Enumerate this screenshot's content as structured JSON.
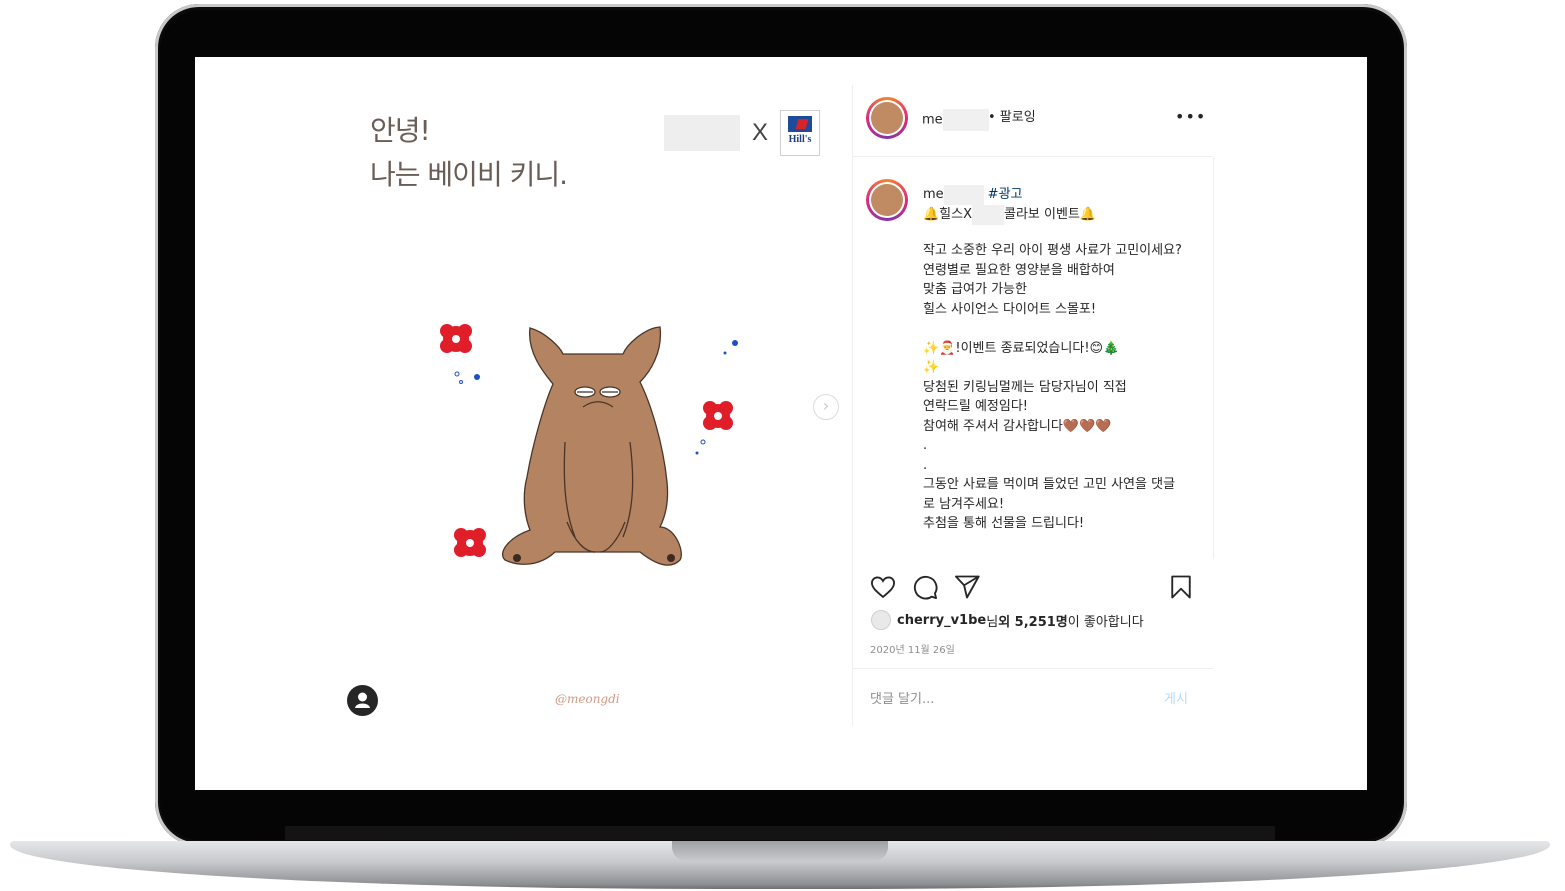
{
  "post_image": {
    "headline_line1": "안녕!",
    "headline_line2": "나는 베이비 키니.",
    "collab_x": "X",
    "partner_logo_text": "Hill's",
    "signature": "@meongdi",
    "next_icon": "chevron-right-icon",
    "tag_icon": "user-tag-icon"
  },
  "header": {
    "username_prefix": "me",
    "follow_label": "• 팔로잉",
    "more_label": "•••"
  },
  "caption": {
    "username_prefix": "me",
    "hashtag": "#광고",
    "title_prefix": "🔔힐스X",
    "title_suffix": "콜라보 이벤트🔔",
    "body": "작고 소중한 우리 아이 평생 사료가 고민이세요?\n연령별로 필요한 영양분을 배합하여\n맞춤 급여가 가능한\n힐스 사이언스 다이어트 스몰포!\n\n✨🎅!이벤트 종료되었습니다!😊🎄\n✨\n당첨된 키링님멀께는 담당자님이 직접\n연락드릴 예정임다!\n참여해 주셔서 감사합니다🤎🤎🤎\n.\n.\n그동안 사료를 먹이며 들었던 고민 사연을 댓글로 남겨주세요!\n추첨을 통해 선물을 드립니다!"
  },
  "actions": {
    "like_icon": "heart-icon",
    "comment_icon": "comment-icon",
    "share_icon": "paper-plane-icon",
    "save_icon": "bookmark-icon"
  },
  "likes": {
    "liker": "cherry_v1be",
    "suffix_1": "님 ",
    "others": "외 5,251명",
    "suffix_2": "이 좋아합니다"
  },
  "date": "2020년 11월 26일",
  "comment": {
    "placeholder": "댓글 달기...",
    "post_label": "게시"
  },
  "colors": {
    "bear_brown": "#b48462",
    "flower_red": "#e01e2a",
    "dot_blue": "#1f4fc4",
    "link_blue": "#00376b",
    "post_btn_disabled": "#b3dbff"
  }
}
